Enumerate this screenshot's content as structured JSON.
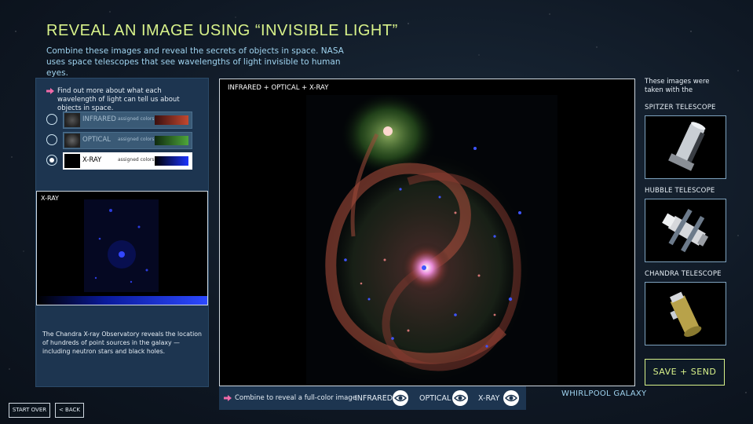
{
  "title": "REVEAL AN IMAGE USING “INVISIBLE LIGHT”",
  "intro": "Combine these images and reveal the secrets of objects in space. NASA uses space telescopes that see wavelengths of light invisible to human eyes.",
  "left_panel": {
    "find_more": "Find out more about what each wavelength of light can tell us about objects in space.",
    "assigned_label": "assigned colors",
    "wavelengths": [
      {
        "name": "INFRARED",
        "selected": false,
        "grad_from": "#3a0f0f",
        "grad_to": "#c3482f"
      },
      {
        "name": "OPTICAL",
        "selected": false,
        "grad_from": "#0f2a0f",
        "grad_to": "#4ea63a"
      },
      {
        "name": "X-RAY",
        "selected": true,
        "grad_from": "#000000",
        "grad_to": "#1d34ff"
      }
    ],
    "preview_label": "X-RAY",
    "description": "The Chandra X-ray Observatory reveals the location of hundreds of point sources in the galaxy — including neutron stars and black holes."
  },
  "main": {
    "image_label": "INFRARED + OPTICAL + X-RAY",
    "combine_text": "Combine to reveal a full-color image",
    "toggles": [
      "INFRARED",
      "OPTICAL",
      "X-RAY"
    ],
    "object_name": "WHIRLPOOL GALAXY"
  },
  "right": {
    "taken_with": "These images were taken with the",
    "telescopes": [
      "SPITZER TELESCOPE",
      "HUBBLE TELESCOPE",
      "CHANDRA TELESCOPE"
    ],
    "save_label": "SAVE + SEND"
  },
  "footer": {
    "start_over": "START OVER",
    "back": "< BACK"
  },
  "colors": {
    "accent": "#d8f28a",
    "link": "#9fd3ef",
    "panel": "#1d3550",
    "arrow": "#f06aa8"
  }
}
